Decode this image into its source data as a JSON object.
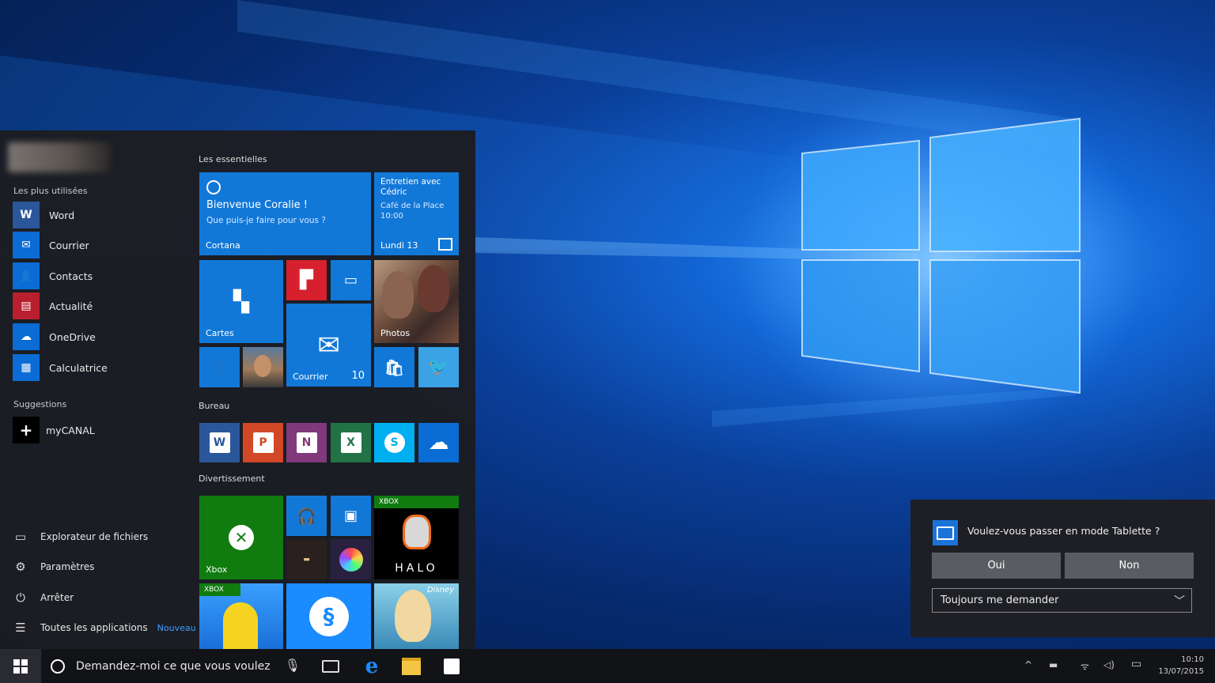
{
  "start_menu": {
    "most_used_label": "Les plus utilisées",
    "apps": [
      {
        "label": "Word",
        "icon": "word-icon",
        "color": "#2b579a",
        "glyph": "W"
      },
      {
        "label": "Courrier",
        "icon": "mail-icon",
        "color": "#0a6cd4",
        "glyph": "✉"
      },
      {
        "label": "Contacts",
        "icon": "people-icon",
        "color": "#0a6cd4",
        "glyph": "👥"
      },
      {
        "label": "Actualité",
        "icon": "news-icon",
        "color": "#b91f2e",
        "glyph": "▤"
      },
      {
        "label": "OneDrive",
        "icon": "cloud-icon",
        "color": "#0a6cd4",
        "glyph": "☁"
      },
      {
        "label": "Calculatrice",
        "icon": "calculator-icon",
        "color": "#0a6cd4",
        "glyph": "▦"
      }
    ],
    "suggestions_label": "Suggestions",
    "suggestion": {
      "label": "myCANAL",
      "icon": "plus-icon",
      "glyph": "+"
    },
    "bottom": [
      {
        "label": "Explorateur de fichiers",
        "icon": "file-explorer-icon",
        "glyph": "▭"
      },
      {
        "label": "Paramètres",
        "icon": "settings-gear-icon",
        "glyph": "⚙"
      },
      {
        "label": "Arrêter",
        "icon": "power-icon",
        "glyph": "⏻"
      },
      {
        "label": "Toutes les applications",
        "icon": "all-apps-icon",
        "glyph": "☰",
        "badge": "Nouveau"
      }
    ],
    "groups": {
      "everyday": "Les essentielles",
      "desktop": "Bureau",
      "entertainment": "Divertissement"
    },
    "tiles": {
      "cortana": {
        "title": "Bienvenue Coralie !",
        "subtitle": "Que puis-je faire pour vous ?",
        "label": "Cortana"
      },
      "calendar": {
        "title": "Entretien avec Cédric",
        "subtitle": "Café de la Place 10:00",
        "label": "Lundi 13"
      },
      "maps": {
        "label": "Cartes"
      },
      "mail": {
        "label": "Courrier",
        "count": "10"
      },
      "photos": {
        "label": "Photos"
      },
      "xbox": {
        "label": "Xbox"
      },
      "xbox_badge": "XBOX",
      "halo": {
        "label": "HALO"
      },
      "disney_badge": "Disney"
    }
  },
  "dialog": {
    "question": "Voulez-vous passer en mode Tablette ?",
    "yes": "Oui",
    "no": "Non",
    "select_value": "Toujours me demander"
  },
  "taskbar": {
    "search_placeholder": "Demandez-moi ce que vous voulez",
    "time": "10:10",
    "date": "13/07/2015"
  }
}
